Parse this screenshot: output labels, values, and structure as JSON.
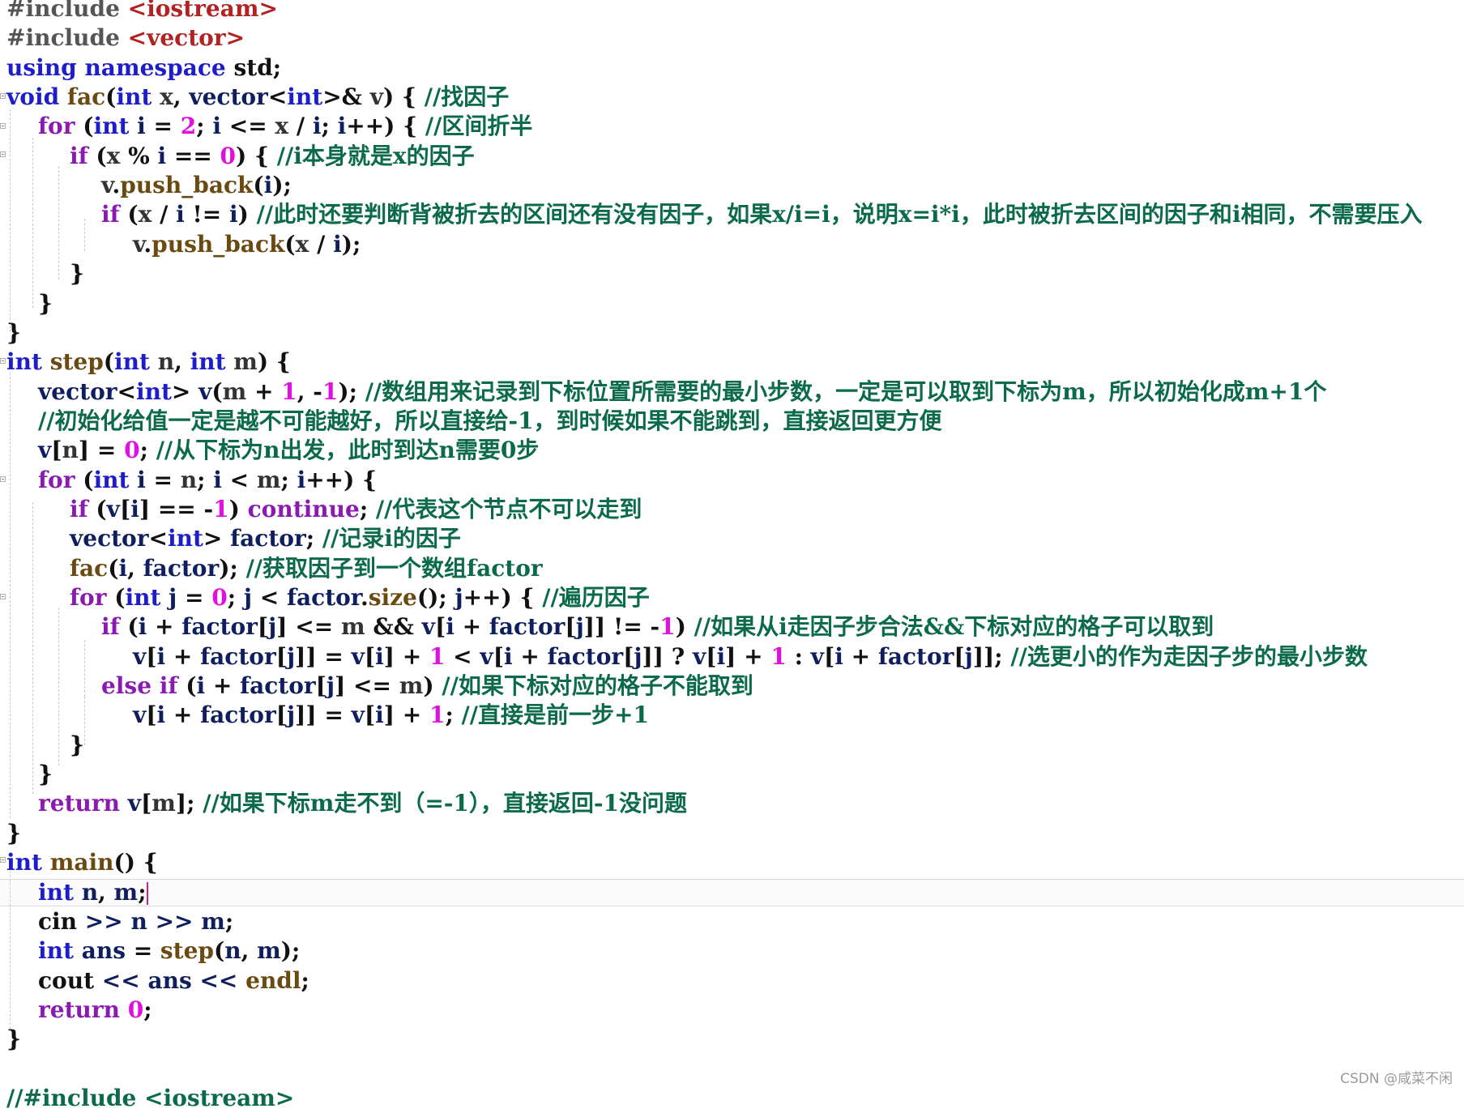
{
  "watermark": "CSDN @咸菜不闲",
  "colors": {
    "background": "#ffffff",
    "preprocessor": "#555555",
    "string": "#b22222",
    "keyword": "#1e1ec8",
    "control": "#8a1bb0",
    "number": "#e011e0",
    "identifier": "#0f1f5e",
    "function": "#6b4a12",
    "comment": "#0c6a4c"
  },
  "code_lines": [
    [
      [
        "pre",
        "#include "
      ],
      [
        "str",
        "<iostream>"
      ]
    ],
    [
      [
        "pre",
        "#include "
      ],
      [
        "str",
        "<vector>"
      ]
    ],
    [
      [
        "kw",
        "using"
      ],
      [
        "tx",
        " "
      ],
      [
        "kw",
        "namespace"
      ],
      [
        "tx",
        " std;"
      ]
    ],
    [
      [
        "type",
        "void"
      ],
      [
        "tx",
        " "
      ],
      [
        "fn",
        "fac"
      ],
      [
        "tx",
        "("
      ],
      [
        "type",
        "int"
      ],
      [
        "tx",
        " "
      ],
      [
        "prm",
        "x"
      ],
      [
        "tx",
        ", "
      ],
      [
        "id",
        "vector"
      ],
      [
        "tx",
        "<"
      ],
      [
        "type",
        "int"
      ],
      [
        "tx",
        ">& "
      ],
      [
        "prm",
        "v"
      ],
      [
        "tx",
        ") { "
      ],
      [
        "cm",
        "//找因子"
      ]
    ],
    [
      [
        "tx",
        "    "
      ],
      [
        "ctl",
        "for"
      ],
      [
        "tx",
        " ("
      ],
      [
        "type",
        "int"
      ],
      [
        "tx",
        " "
      ],
      [
        "id",
        "i"
      ],
      [
        "tx",
        " = "
      ],
      [
        "num",
        "2"
      ],
      [
        "tx",
        "; "
      ],
      [
        "id",
        "i"
      ],
      [
        "tx",
        " <= "
      ],
      [
        "prm",
        "x"
      ],
      [
        "tx",
        " / "
      ],
      [
        "id",
        "i"
      ],
      [
        "tx",
        "; "
      ],
      [
        "id",
        "i"
      ],
      [
        "tx",
        "++) { "
      ],
      [
        "cm",
        "//区间折半"
      ]
    ],
    [
      [
        "tx",
        "        "
      ],
      [
        "ctl",
        "if"
      ],
      [
        "tx",
        " ("
      ],
      [
        "prm",
        "x"
      ],
      [
        "tx",
        " % "
      ],
      [
        "id",
        "i"
      ],
      [
        "tx",
        " == "
      ],
      [
        "num",
        "0"
      ],
      [
        "tx",
        ") { "
      ],
      [
        "cm",
        "//i本身就是x的因子"
      ]
    ],
    [
      [
        "tx",
        "            "
      ],
      [
        "prm",
        "v"
      ],
      [
        "tx",
        "."
      ],
      [
        "fn",
        "push_back"
      ],
      [
        "tx",
        "("
      ],
      [
        "id",
        "i"
      ],
      [
        "tx",
        ");"
      ]
    ],
    [
      [
        "tx",
        "            "
      ],
      [
        "ctl",
        "if"
      ],
      [
        "tx",
        " ("
      ],
      [
        "prm",
        "x"
      ],
      [
        "tx",
        " / "
      ],
      [
        "id",
        "i"
      ],
      [
        "tx",
        " != "
      ],
      [
        "id",
        "i"
      ],
      [
        "tx",
        ") "
      ],
      [
        "cm",
        "//此时还要判断背被折去的区间还有没有因子，如果x/i=i，说明x=i*i，此时被折去区间的因子和i相同，不需要压入"
      ]
    ],
    [
      [
        "tx",
        "                "
      ],
      [
        "prm",
        "v"
      ],
      [
        "tx",
        "."
      ],
      [
        "fn",
        "push_back"
      ],
      [
        "tx",
        "("
      ],
      [
        "prm",
        "x"
      ],
      [
        "tx",
        " / "
      ],
      [
        "id",
        "i"
      ],
      [
        "tx",
        ");"
      ]
    ],
    [
      [
        "tx",
        "        }"
      ]
    ],
    [
      [
        "tx",
        "    }"
      ]
    ],
    [
      [
        "tx",
        "}"
      ]
    ],
    [
      [
        "type",
        "int"
      ],
      [
        "tx",
        " "
      ],
      [
        "fn",
        "step"
      ],
      [
        "tx",
        "("
      ],
      [
        "type",
        "int"
      ],
      [
        "tx",
        " "
      ],
      [
        "prm",
        "n"
      ],
      [
        "tx",
        ", "
      ],
      [
        "type",
        "int"
      ],
      [
        "tx",
        " "
      ],
      [
        "prm",
        "m"
      ],
      [
        "tx",
        ") {"
      ]
    ],
    [
      [
        "tx",
        "    "
      ],
      [
        "id",
        "vector"
      ],
      [
        "tx",
        "<"
      ],
      [
        "type",
        "int"
      ],
      [
        "tx",
        "> "
      ],
      [
        "id",
        "v"
      ],
      [
        "tx",
        "("
      ],
      [
        "prm",
        "m"
      ],
      [
        "tx",
        " + "
      ],
      [
        "num",
        "1"
      ],
      [
        "tx",
        ", -"
      ],
      [
        "num",
        "1"
      ],
      [
        "tx",
        "); "
      ],
      [
        "cm",
        "//数组用来记录到下标位置所需要的最小步数，一定是可以取到下标为m，所以初始化成m+1个"
      ]
    ],
    [
      [
        "tx",
        "    "
      ],
      [
        "cm",
        "//初始化给值一定是越不可能越好，所以直接给-1，到时候如果不能跳到，直接返回更方便"
      ]
    ],
    [
      [
        "tx",
        "    "
      ],
      [
        "id",
        "v"
      ],
      [
        "tx",
        "["
      ],
      [
        "prm",
        "n"
      ],
      [
        "tx",
        "] = "
      ],
      [
        "num",
        "0"
      ],
      [
        "tx",
        "; "
      ],
      [
        "cm",
        "//从下标为n出发，此时到达n需要0步"
      ]
    ],
    [
      [
        "tx",
        "    "
      ],
      [
        "ctl",
        "for"
      ],
      [
        "tx",
        " ("
      ],
      [
        "type",
        "int"
      ],
      [
        "tx",
        " "
      ],
      [
        "id",
        "i"
      ],
      [
        "tx",
        " = "
      ],
      [
        "prm",
        "n"
      ],
      [
        "tx",
        "; "
      ],
      [
        "id",
        "i"
      ],
      [
        "tx",
        " < "
      ],
      [
        "prm",
        "m"
      ],
      [
        "tx",
        "; "
      ],
      [
        "id",
        "i"
      ],
      [
        "tx",
        "++) {"
      ]
    ],
    [
      [
        "tx",
        "        "
      ],
      [
        "ctl",
        "if"
      ],
      [
        "tx",
        " ("
      ],
      [
        "id",
        "v"
      ],
      [
        "tx",
        "["
      ],
      [
        "id",
        "i"
      ],
      [
        "tx",
        "] == -"
      ],
      [
        "num",
        "1"
      ],
      [
        "tx",
        ") "
      ],
      [
        "ctl",
        "continue"
      ],
      [
        "tx",
        "; "
      ],
      [
        "cm",
        "//代表这个节点不可以走到"
      ]
    ],
    [
      [
        "tx",
        "        "
      ],
      [
        "id",
        "vector"
      ],
      [
        "tx",
        "<"
      ],
      [
        "type",
        "int"
      ],
      [
        "tx",
        "> "
      ],
      [
        "id",
        "factor"
      ],
      [
        "tx",
        "; "
      ],
      [
        "cm",
        "//记录i的因子"
      ]
    ],
    [
      [
        "tx",
        "        "
      ],
      [
        "fn",
        "fac"
      ],
      [
        "tx",
        "("
      ],
      [
        "id",
        "i"
      ],
      [
        "tx",
        ", "
      ],
      [
        "id",
        "factor"
      ],
      [
        "tx",
        "); "
      ],
      [
        "cm",
        "//获取因子到一个数组factor"
      ]
    ],
    [
      [
        "tx",
        "        "
      ],
      [
        "ctl",
        "for"
      ],
      [
        "tx",
        " ("
      ],
      [
        "type",
        "int"
      ],
      [
        "tx",
        " "
      ],
      [
        "id",
        "j"
      ],
      [
        "tx",
        " = "
      ],
      [
        "num",
        "0"
      ],
      [
        "tx",
        "; "
      ],
      [
        "id",
        "j"
      ],
      [
        "tx",
        " < "
      ],
      [
        "id",
        "factor"
      ],
      [
        "tx",
        "."
      ],
      [
        "fn",
        "size"
      ],
      [
        "tx",
        "(); "
      ],
      [
        "id",
        "j"
      ],
      [
        "tx",
        "++) { "
      ],
      [
        "cm",
        "//遍历因子"
      ]
    ],
    [
      [
        "tx",
        "            "
      ],
      [
        "ctl",
        "if"
      ],
      [
        "tx",
        " ("
      ],
      [
        "id",
        "i"
      ],
      [
        "tx",
        " + "
      ],
      [
        "id",
        "factor"
      ],
      [
        "tx",
        "["
      ],
      [
        "id",
        "j"
      ],
      [
        "tx",
        "] <= "
      ],
      [
        "prm",
        "m"
      ],
      [
        "tx",
        " && "
      ],
      [
        "id",
        "v"
      ],
      [
        "tx",
        "["
      ],
      [
        "id",
        "i"
      ],
      [
        "tx",
        " + "
      ],
      [
        "id",
        "factor"
      ],
      [
        "tx",
        "["
      ],
      [
        "id",
        "j"
      ],
      [
        "tx",
        "]] != -"
      ],
      [
        "num",
        "1"
      ],
      [
        "tx",
        ") "
      ],
      [
        "cm",
        "//如果从i走因子步合法&&下标对应的格子可以取到"
      ]
    ],
    [
      [
        "tx",
        "                "
      ],
      [
        "id",
        "v"
      ],
      [
        "tx",
        "["
      ],
      [
        "id",
        "i"
      ],
      [
        "tx",
        " + "
      ],
      [
        "id",
        "factor"
      ],
      [
        "tx",
        "["
      ],
      [
        "id",
        "j"
      ],
      [
        "tx",
        "]] = "
      ],
      [
        "id",
        "v"
      ],
      [
        "tx",
        "["
      ],
      [
        "id",
        "i"
      ],
      [
        "tx",
        "] + "
      ],
      [
        "num",
        "1"
      ],
      [
        "tx",
        " < "
      ],
      [
        "id",
        "v"
      ],
      [
        "tx",
        "["
      ],
      [
        "id",
        "i"
      ],
      [
        "tx",
        " + "
      ],
      [
        "id",
        "factor"
      ],
      [
        "tx",
        "["
      ],
      [
        "id",
        "j"
      ],
      [
        "tx",
        "]] ? "
      ],
      [
        "id",
        "v"
      ],
      [
        "tx",
        "["
      ],
      [
        "id",
        "i"
      ],
      [
        "tx",
        "] + "
      ],
      [
        "num",
        "1"
      ],
      [
        "tx",
        " : "
      ],
      [
        "id",
        "v"
      ],
      [
        "tx",
        "["
      ],
      [
        "id",
        "i"
      ],
      [
        "tx",
        " + "
      ],
      [
        "id",
        "factor"
      ],
      [
        "tx",
        "["
      ],
      [
        "id",
        "j"
      ],
      [
        "tx",
        "]]; "
      ],
      [
        "cm",
        "//选更小的作为走因子步的最小步数"
      ]
    ],
    [
      [
        "tx",
        "            "
      ],
      [
        "ctl",
        "else"
      ],
      [
        "tx",
        " "
      ],
      [
        "ctl",
        "if"
      ],
      [
        "tx",
        " ("
      ],
      [
        "id",
        "i"
      ],
      [
        "tx",
        " + "
      ],
      [
        "id",
        "factor"
      ],
      [
        "tx",
        "["
      ],
      [
        "id",
        "j"
      ],
      [
        "tx",
        "] <= "
      ],
      [
        "prm",
        "m"
      ],
      [
        "tx",
        ") "
      ],
      [
        "cm",
        "//如果下标对应的格子不能取到"
      ]
    ],
    [
      [
        "tx",
        "                "
      ],
      [
        "id",
        "v"
      ],
      [
        "tx",
        "["
      ],
      [
        "id",
        "i"
      ],
      [
        "tx",
        " + "
      ],
      [
        "id",
        "factor"
      ],
      [
        "tx",
        "["
      ],
      [
        "id",
        "j"
      ],
      [
        "tx",
        "]] = "
      ],
      [
        "id",
        "v"
      ],
      [
        "tx",
        "["
      ],
      [
        "id",
        "i"
      ],
      [
        "tx",
        "] + "
      ],
      [
        "num",
        "1"
      ],
      [
        "tx",
        "; "
      ],
      [
        "cm",
        "//直接是前一步+1"
      ]
    ],
    [
      [
        "tx",
        "        }"
      ]
    ],
    [
      [
        "tx",
        "    }"
      ]
    ],
    [
      [
        "tx",
        "    "
      ],
      [
        "ctl",
        "return"
      ],
      [
        "tx",
        " "
      ],
      [
        "id",
        "v"
      ],
      [
        "tx",
        "["
      ],
      [
        "prm",
        "m"
      ],
      [
        "tx",
        "]; "
      ],
      [
        "cm",
        "//如果下标m走不到（=-1），直接返回-1没问题"
      ]
    ],
    [
      [
        "tx",
        "}"
      ]
    ],
    [
      [
        "type",
        "int"
      ],
      [
        "tx",
        " "
      ],
      [
        "fn",
        "main"
      ],
      [
        "tx",
        "() {"
      ]
    ],
    [
      [
        "tx",
        "    "
      ],
      [
        "type",
        "int"
      ],
      [
        "tx",
        " "
      ],
      [
        "id",
        "n"
      ],
      [
        "tx",
        ", "
      ],
      [
        "id",
        "m"
      ],
      [
        "tx",
        ";"
      ]
    ],
    [
      [
        "tx",
        "    cin "
      ],
      [
        "id",
        ">>"
      ],
      [
        "tx",
        " "
      ],
      [
        "id",
        "n"
      ],
      [
        "tx",
        " "
      ],
      [
        "id",
        ">>"
      ],
      [
        "tx",
        " "
      ],
      [
        "id",
        "m"
      ],
      [
        "tx",
        ";"
      ]
    ],
    [
      [
        "tx",
        "    "
      ],
      [
        "type",
        "int"
      ],
      [
        "tx",
        " "
      ],
      [
        "id",
        "ans"
      ],
      [
        "tx",
        " = "
      ],
      [
        "fn",
        "step"
      ],
      [
        "tx",
        "("
      ],
      [
        "id",
        "n"
      ],
      [
        "tx",
        ", "
      ],
      [
        "id",
        "m"
      ],
      [
        "tx",
        ");"
      ]
    ],
    [
      [
        "tx",
        "    cout "
      ],
      [
        "id",
        "<<"
      ],
      [
        "tx",
        " "
      ],
      [
        "id",
        "ans"
      ],
      [
        "tx",
        " "
      ],
      [
        "id",
        "<<"
      ],
      [
        "tx",
        " "
      ],
      [
        "fn",
        "endl"
      ],
      [
        "tx",
        ";"
      ]
    ],
    [
      [
        "tx",
        "    "
      ],
      [
        "ctl",
        "return"
      ],
      [
        "tx",
        " "
      ],
      [
        "num",
        "0"
      ],
      [
        "tx",
        ";"
      ]
    ],
    [
      [
        "tx",
        "}"
      ]
    ],
    [
      [
        "tx",
        ""
      ]
    ],
    [
      [
        "cm",
        "//#include <iostream>"
      ]
    ]
  ]
}
